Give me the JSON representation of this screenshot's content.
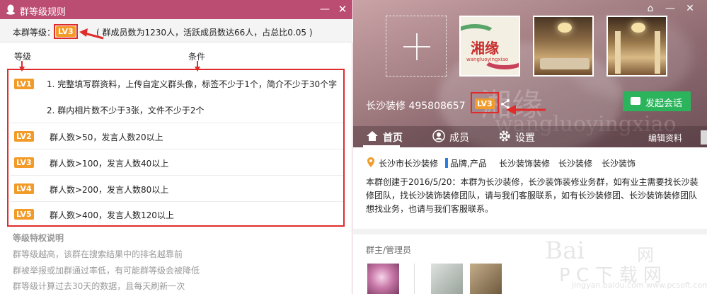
{
  "dialog": {
    "title": "群等级规则",
    "level_label": "本群等级：",
    "current_level": "LV3",
    "level_info": "( 群成员数为1230人，活跃成员数达66人，占总比0.05 )",
    "col_level": "等级",
    "col_condition": "条件",
    "rules": [
      {
        "level": "LV1",
        "lines": [
          "1. 完整填写群资料，上传自定义群头像，标签不少于1个，简介不少于30个字",
          "2. 群内相片数不少于3张，文件不少于2个"
        ]
      },
      {
        "level": "LV2",
        "lines": [
          "群人数>50，发言人数20以上"
        ]
      },
      {
        "level": "LV3",
        "lines": [
          "群人数>100，发言人数40以上"
        ]
      },
      {
        "level": "LV4",
        "lines": [
          "群人数>200，发言人数80以上"
        ]
      },
      {
        "level": "LV5",
        "lines": [
          "群人数>400，发言人数120以上"
        ]
      }
    ],
    "privilege_title": "等级特权说明",
    "privileges": [
      "群等级越高，该群在搜索结果中的排名越靠前",
      "群被举报或加群通过率低，有可能群等级会被降低",
      "群等级计算过去30天的数据，且每天刷新一次"
    ]
  },
  "profile": {
    "hero_brand": "湘缘",
    "hero_brand_url": "wangluoyingxiao",
    "group_name": "长沙装修 495808657",
    "level": "LV3",
    "chat_button": "发起会话",
    "tabs": [
      "首页",
      "成员",
      "设置"
    ],
    "edit_link": "编辑资料",
    "location": "长沙市长沙装修",
    "tags": [
      "品牌,产品",
      "长沙装饰装修",
      "长沙装修",
      "长沙装饰"
    ],
    "description": "本群创建于2016/5/20：本群为长沙装修，长沙装饰装修业务群，如有业主需要找长沙装修团队，找长沙装饰装修团队，请与我们客服联系，如有长沙装修团、长沙装饰装修团队想找业务，也请与我们客服联系。",
    "admins_title": "群主/管理员"
  },
  "watermark": {
    "line1": "Bai",
    "line2": "P C 下 载 网",
    "line3": "jingyan.baidu.com  www.pcsoft.com.cn",
    "line4": "网"
  },
  "colors": {
    "titlebar": "#bc4d72",
    "level_tag": "#f29b29",
    "annotation_red": "#e02b2b",
    "chat_green": "#2cb45d"
  }
}
